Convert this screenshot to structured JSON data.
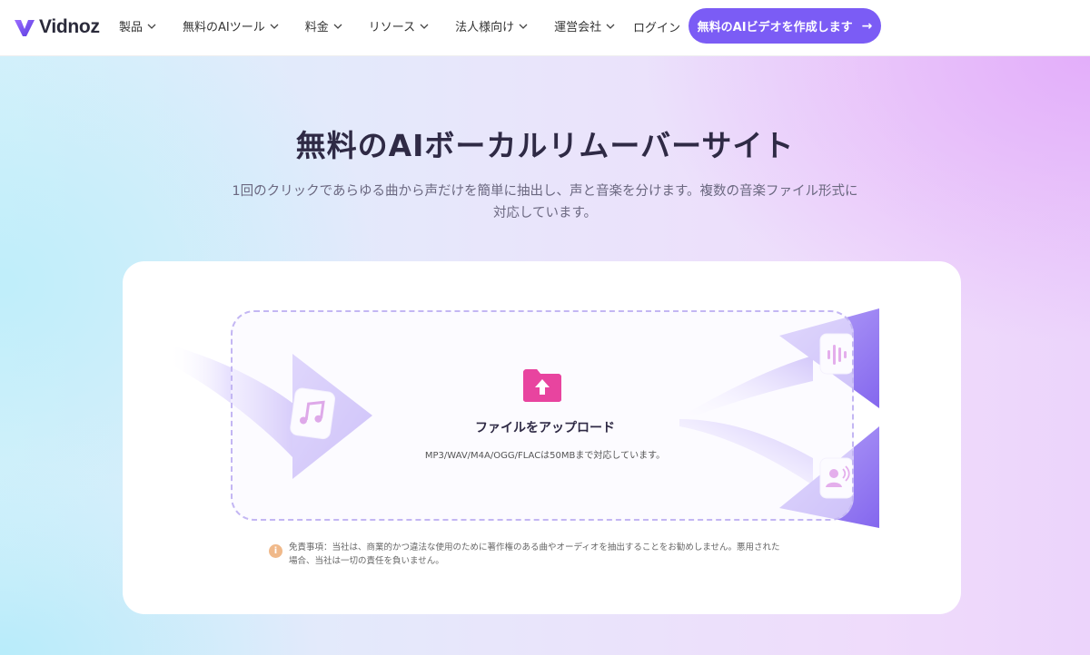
{
  "brand": {
    "name": "Vidnoz",
    "accent": "#7b5cf5"
  },
  "nav": {
    "items": [
      {
        "label": "製品"
      },
      {
        "label": "無料のAIツール"
      },
      {
        "label": "料金"
      },
      {
        "label": "リソース"
      },
      {
        "label": "法人様向け"
      },
      {
        "label": "運営会社"
      }
    ],
    "login": "ログイン",
    "cta": "無料のAIビデオを作成します",
    "cta_icon": "arrow-right-icon"
  },
  "hero": {
    "title": "無料のAIボーカルリムーバーサイト",
    "subtitle_line1": "1回のクリックであらゆる曲から声だけを簡単に抽出し、声と音楽を分けます。複数の音楽ファイル形式に",
    "subtitle_line2": "対応しています。"
  },
  "uploader": {
    "label": "ファイルをアップロード",
    "note": "MP3/WAV/M4A/OGG/FLACは50MBまで対応しています。",
    "icons": [
      "music-note-icon",
      "folder-upload-icon",
      "waveform-icon",
      "voice-person-icon"
    ]
  },
  "disclaimer": {
    "line1": "免責事項：当社は、商業的かつ違法な使用のために著作権のある曲やオーディオを抽出することをお勧めしません。悪用された",
    "line2": "場合、当社は一切の責任を負いません。"
  }
}
